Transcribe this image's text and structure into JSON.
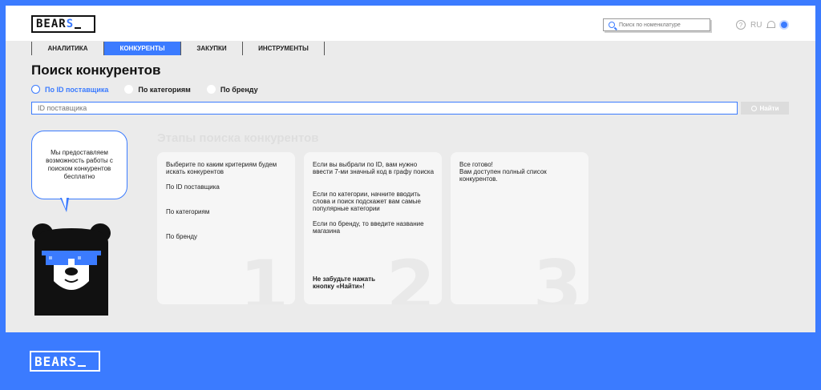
{
  "brand": {
    "logo_text": "BEAR",
    "logo_highlight": "S"
  },
  "header": {
    "search_placeholder": "Поиск по номенклатуре",
    "help_symbol": "?",
    "language": "RU"
  },
  "tabs": [
    {
      "label": "АНАЛИТИКА",
      "active": false
    },
    {
      "label": "КОНКУРЕНТЫ",
      "active": true
    },
    {
      "label": "ЗАКУПКИ",
      "active": false
    },
    {
      "label": "ИНСТРУМЕНТЫ",
      "active": false
    }
  ],
  "page": {
    "title": "Поиск конкурентов",
    "radios": [
      "По ID поставщика",
      "По категориям",
      "По бренду"
    ],
    "selected_radio": "По ID поставщика",
    "input_placeholder": "ID поставщика",
    "find_button": "Найти"
  },
  "stages": {
    "title": "Этапы поиска конкурентов",
    "card1": {
      "intro": "Выберите по каким критериям будем искать конкурентов",
      "options": [
        "По ID поставщика",
        "По категориям",
        "По бренду"
      ],
      "number": "1"
    },
    "card2": {
      "p1": "Если вы выбрали по ID, вам нужно ввести 7-ми значный код в графу поиска",
      "p2": "Если по категории, начните вводить слова и поиск подскажет вам самые популярные категории",
      "p3": "Если по бренду, то введите название магазина",
      "note": "Не забудьте нажать кнопку «Найти»!",
      "number": "2"
    },
    "card3": {
      "p1": "Все готово!",
      "p2": "Вам доступен полный список конкурентов.",
      "number": "3"
    }
  },
  "mascot": {
    "bubble_text": "Мы предоставляем возможность работы с поиском конкурентов бесплатно"
  },
  "colors": {
    "accent": "#3b7bff",
    "background": "#ebebeb",
    "card": "#f6f6f6"
  }
}
